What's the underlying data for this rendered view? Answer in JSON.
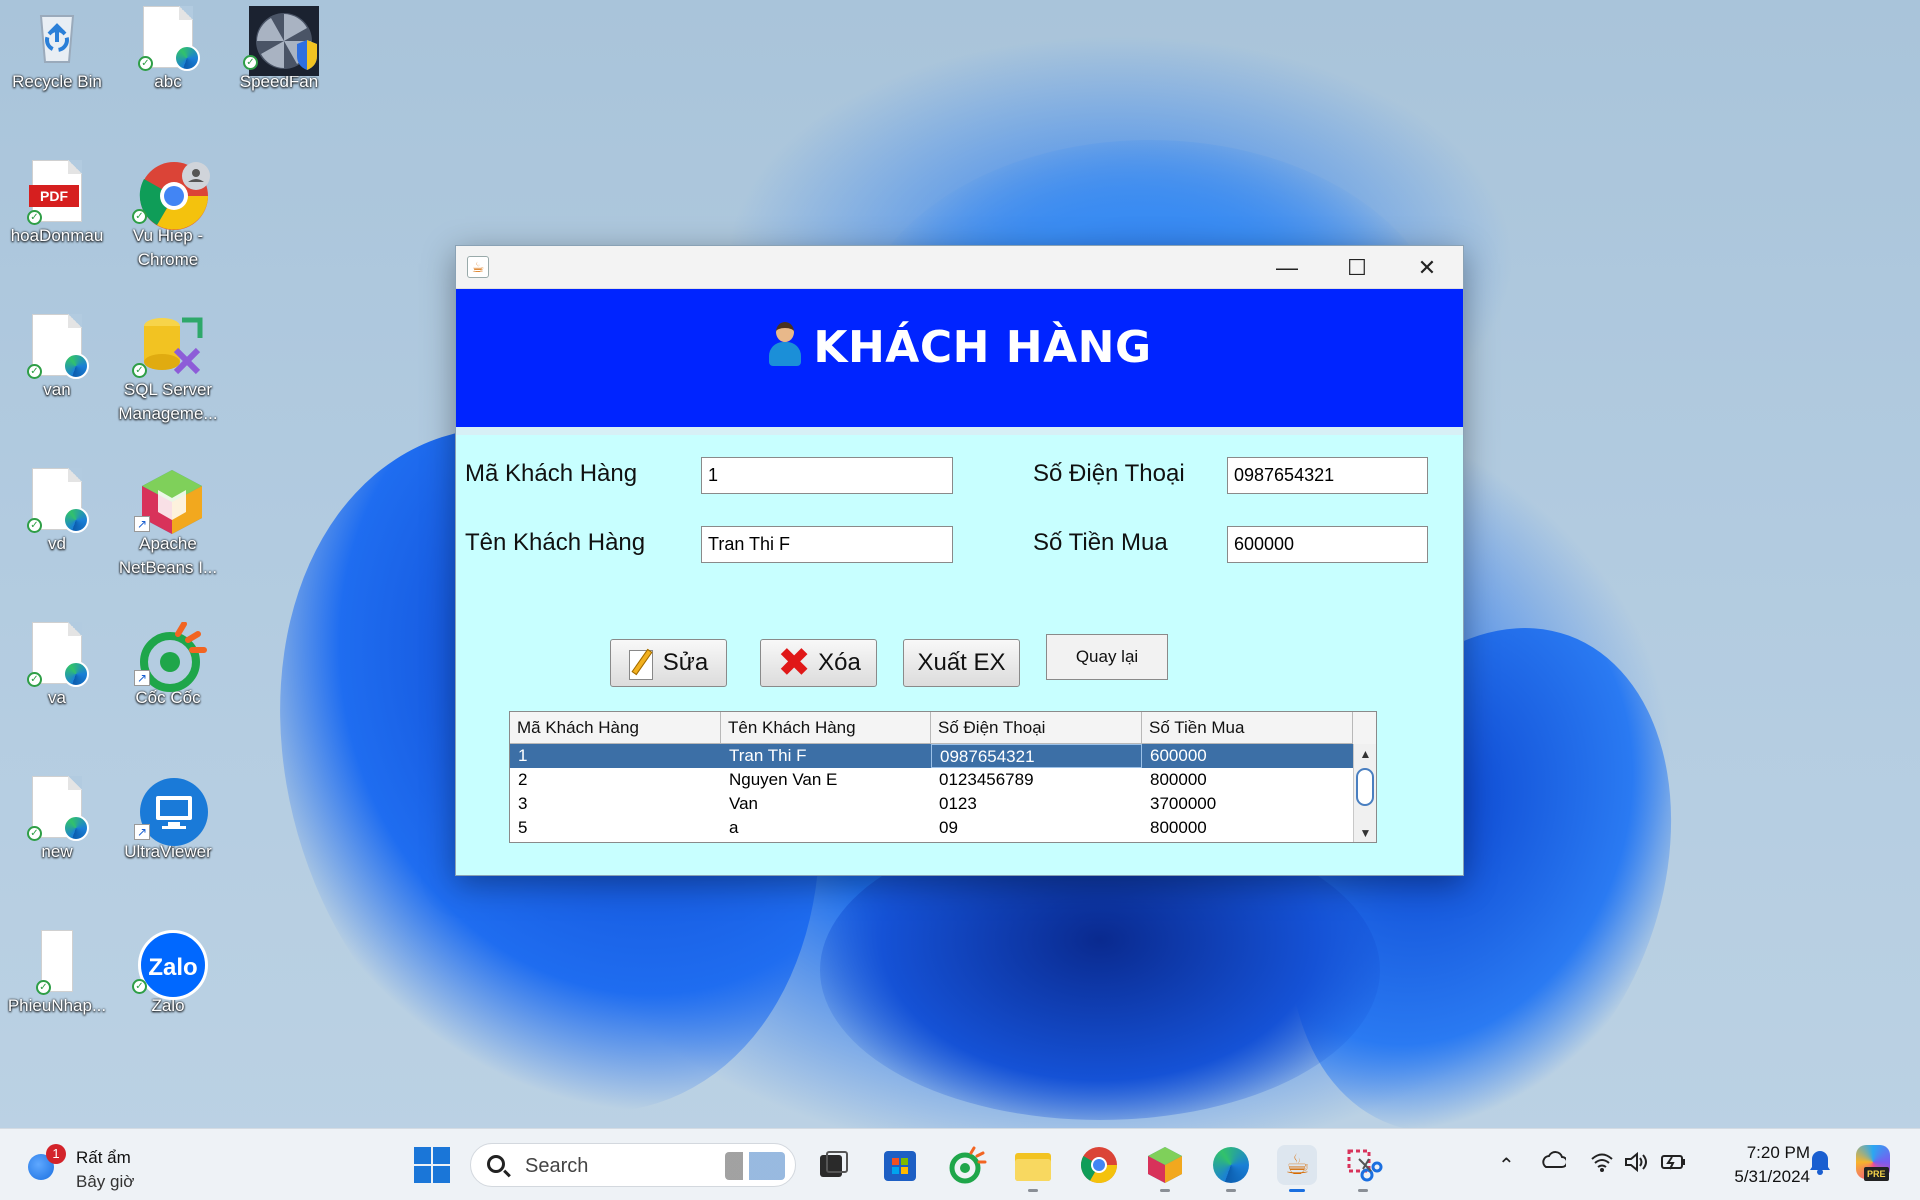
{
  "desktop": {
    "icons": [
      {
        "label": "Recycle Bin"
      },
      {
        "label": "abc"
      },
      {
        "label": "SpeedFan"
      },
      {
        "label": "hoaDonmau"
      },
      {
        "label": "Vu Hiep -\nChrome"
      },
      {
        "label": "van"
      },
      {
        "label": "SQL Server\nManageme..."
      },
      {
        "label": "vd"
      },
      {
        "label": "Apache\nNetBeans I..."
      },
      {
        "label": "va"
      },
      {
        "label": "Cốc Cốc"
      },
      {
        "label": "new"
      },
      {
        "label": "UltraViewer"
      },
      {
        "label": "PhieuNhap..."
      },
      {
        "label": "Zalo"
      }
    ],
    "pdf_badge": "PDF",
    "zalo_badge": "Zalo"
  },
  "window": {
    "header_title": "KHÁCH HÀNG",
    "controls": {
      "minimize": "—",
      "maximize": "☐",
      "close": "✕"
    },
    "form": {
      "ma_kh_label": "Mã Khách Hàng",
      "ma_kh_value": "1",
      "ten_kh_label": "Tên Khách Hàng",
      "ten_kh_value": "Tran Thi F",
      "sdt_label": "Số Điện Thoại",
      "sdt_value": "0987654321",
      "tien_label": "Số Tiền Mua",
      "tien_value": "600000"
    },
    "buttons": {
      "sua": "Sửa",
      "xoa": "Xóa",
      "xuat": "Xuất EX",
      "quay_lai": "Quay lại"
    },
    "table": {
      "columns": [
        "Mã Khách Hàng",
        "Tên Khách Hàng",
        "Số Điện Thoại",
        "Số Tiền Mua"
      ],
      "rows": [
        [
          "1",
          "Tran Thi F",
          "0987654321",
          "600000"
        ],
        [
          "2",
          "Nguyen Van E",
          "0123456789",
          "800000"
        ],
        [
          "3",
          "Van",
          "0123",
          "3700000"
        ],
        [
          "5",
          "a",
          "09",
          "800000"
        ]
      ],
      "selected_row": 0
    }
  },
  "taskbar": {
    "weather_text": "Rất ẩm",
    "weather_sub": "Bây giờ",
    "notification_count": "1",
    "search_placeholder": "Search",
    "time": "7:20 PM",
    "date": "5/31/2024",
    "copilot_badge": "PRE"
  }
}
